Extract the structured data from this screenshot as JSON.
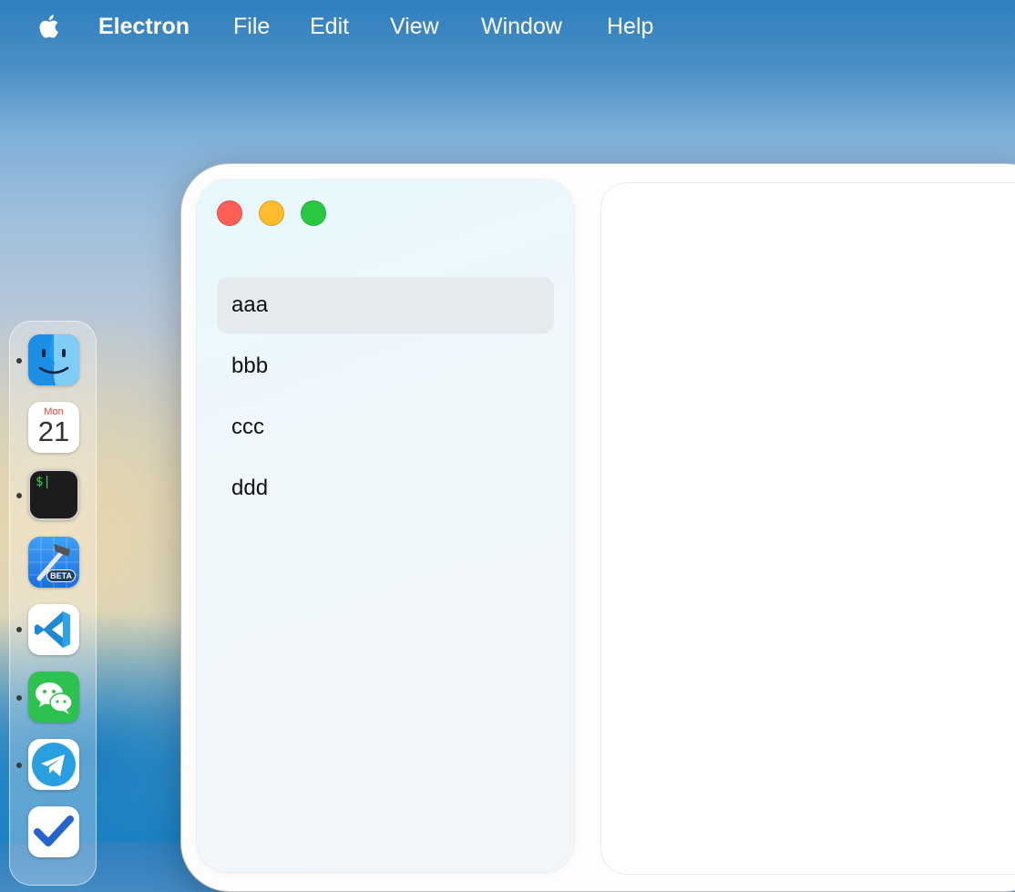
{
  "menubar": {
    "app_name": "Electron",
    "items": [
      "File",
      "Edit",
      "View",
      "Window",
      "Help"
    ]
  },
  "dock": {
    "apps": [
      {
        "icon": "finder-icon",
        "running": true
      },
      {
        "icon": "calendar-icon",
        "running": false,
        "day": "Mon",
        "date": "21"
      },
      {
        "icon": "terminal-icon",
        "running": true,
        "prompt": "$|"
      },
      {
        "icon": "xcode-beta-icon",
        "running": false,
        "badge": "BETA"
      },
      {
        "icon": "vscode-icon",
        "running": true
      },
      {
        "icon": "wechat-icon",
        "running": true
      },
      {
        "icon": "telegram-icon",
        "running": true
      },
      {
        "icon": "todo-icon",
        "running": false
      }
    ]
  },
  "window": {
    "sidebar": {
      "items": [
        {
          "label": "aaa",
          "active": true
        },
        {
          "label": "bbb",
          "active": false
        },
        {
          "label": "ccc",
          "active": false
        },
        {
          "label": "ddd",
          "active": false
        }
      ]
    }
  },
  "colors": {
    "close": "#ff5f57",
    "minimize": "#febc2e",
    "maximize": "#28c840",
    "selected_item": "#e5ebef"
  }
}
